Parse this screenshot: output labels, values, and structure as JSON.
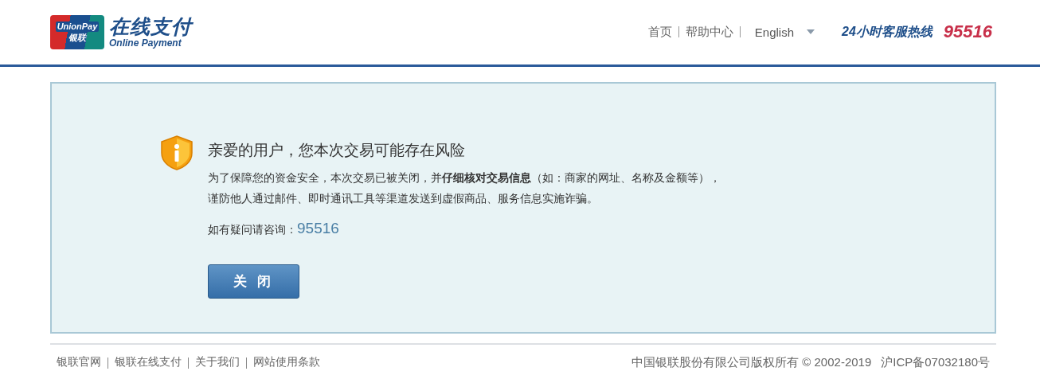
{
  "logo": {
    "card_brand": "UnionPay",
    "card_cn": "银联",
    "title": "在线支付",
    "subtitle": "Online Payment"
  },
  "nav": {
    "links": [
      "首页",
      "帮助中心"
    ],
    "language": "English",
    "hotline_label": "24小时客服热线",
    "hotline_number": "95516"
  },
  "notice": {
    "heading": "亲爱的用户，您本次交易可能存在风险",
    "body": [
      "为了保障您的资金安全，本次交易已被关闭，并**仔细核对交易信息**（如：商家的网址、名称及金额等），",
      "谨防他人通过邮件、即时通讯工具等渠道发送到虚假商品、服务信息实施诈骗。"
    ],
    "contact_label": "如有疑问请咨询：",
    "contact_number": "95516",
    "button": "关 闭"
  },
  "footer": {
    "links": [
      "银联官网",
      "银联在线支付",
      "关于我们",
      "网站使用条款"
    ],
    "copyright": "中国银联股份有限公司版权所有 © 2002-2019",
    "icp": "沪ICP备07032180号"
  }
}
